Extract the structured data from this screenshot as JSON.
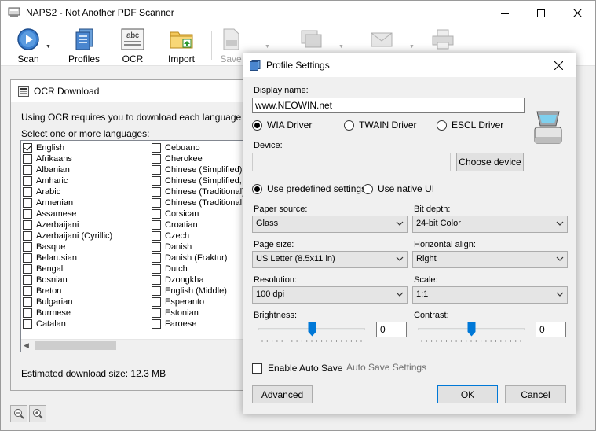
{
  "window": {
    "title": "NAPS2 - Not Another PDF Scanner"
  },
  "toolbar": {
    "scan": "Scan",
    "profiles": "Profiles",
    "ocr": "OCR",
    "import": "Import",
    "save": "Save",
    "ocr_icon_text": "abc"
  },
  "ocr_panel": {
    "title": "OCR Download",
    "intro": "Using OCR requires you to download each language you wa",
    "select_label": "Select one or more languages:",
    "estimated_size": "Estimated download size: 12.3 MB",
    "languages_col1": [
      {
        "name": "English",
        "checked": true
      },
      {
        "name": "Afrikaans",
        "checked": false
      },
      {
        "name": "Albanian",
        "checked": false
      },
      {
        "name": "Amharic",
        "checked": false
      },
      {
        "name": "Arabic",
        "checked": false
      },
      {
        "name": "Armenian",
        "checked": false
      },
      {
        "name": "Assamese",
        "checked": false
      },
      {
        "name": "Azerbaijani",
        "checked": false
      },
      {
        "name": "Azerbaijani (Cyrillic)",
        "checked": false
      },
      {
        "name": "Basque",
        "checked": false
      },
      {
        "name": "Belarusian",
        "checked": false
      },
      {
        "name": "Bengali",
        "checked": false
      },
      {
        "name": "Bosnian",
        "checked": false
      },
      {
        "name": "Breton",
        "checked": false
      },
      {
        "name": "Bulgarian",
        "checked": false
      },
      {
        "name": "Burmese",
        "checked": false
      },
      {
        "name": "Catalan",
        "checked": false
      }
    ],
    "languages_col2": [
      {
        "name": "Cebuano",
        "checked": false
      },
      {
        "name": "Cherokee",
        "checked": false
      },
      {
        "name": "Chinese (Simplified)",
        "checked": false
      },
      {
        "name": "Chinese (Simplified, V",
        "checked": false
      },
      {
        "name": "Chinese (Traditional)",
        "checked": false
      },
      {
        "name": "Chinese (Traditional, V",
        "checked": false
      },
      {
        "name": "Corsican",
        "checked": false
      },
      {
        "name": "Croatian",
        "checked": false
      },
      {
        "name": "Czech",
        "checked": false
      },
      {
        "name": "Danish",
        "checked": false
      },
      {
        "name": "Danish (Fraktur)",
        "checked": false
      },
      {
        "name": "Dutch",
        "checked": false
      },
      {
        "name": "Dzongkha",
        "checked": false
      },
      {
        "name": "English (Middle)",
        "checked": false
      },
      {
        "name": "Esperanto",
        "checked": false
      },
      {
        "name": "Estonian",
        "checked": false
      },
      {
        "name": "Faroese",
        "checked": false
      }
    ]
  },
  "profile_dialog": {
    "title": "Profile Settings",
    "display_name_label": "Display name:",
    "display_name_value": "www.NEOWIN.net",
    "driver_wia": "WIA Driver",
    "driver_twain": "TWAIN Driver",
    "driver_escl": "ESCL Driver",
    "selected_driver": "wia",
    "device_label": "Device:",
    "device_value": "",
    "choose_device": "Choose device",
    "use_predefined": "Use predefined settings",
    "use_native": "Use native UI",
    "selected_settings_mode": "predefined",
    "paper_source_label": "Paper source:",
    "paper_source_value": "Glass",
    "bit_depth_label": "Bit depth:",
    "bit_depth_value": "24-bit Color",
    "page_size_label": "Page size:",
    "page_size_value": "US Letter (8.5x11 in)",
    "horizontal_align_label": "Horizontal align:",
    "horizontal_align_value": "Right",
    "resolution_label": "Resolution:",
    "resolution_value": "100 dpi",
    "scale_label": "Scale:",
    "scale_value": "1:1",
    "brightness_label": "Brightness:",
    "brightness_value": "0",
    "brightness_level": 0.5,
    "contrast_label": "Contrast:",
    "contrast_value": "0",
    "contrast_level": 0.5,
    "enable_auto_save": "Enable Auto Save",
    "auto_save_checked": false,
    "auto_save_settings": "Auto Save Settings",
    "advanced": "Advanced",
    "ok": "OK",
    "cancel": "Cancel"
  },
  "colors": {
    "accent": "#0078d7",
    "disabled_text": "#6d6d6d"
  }
}
